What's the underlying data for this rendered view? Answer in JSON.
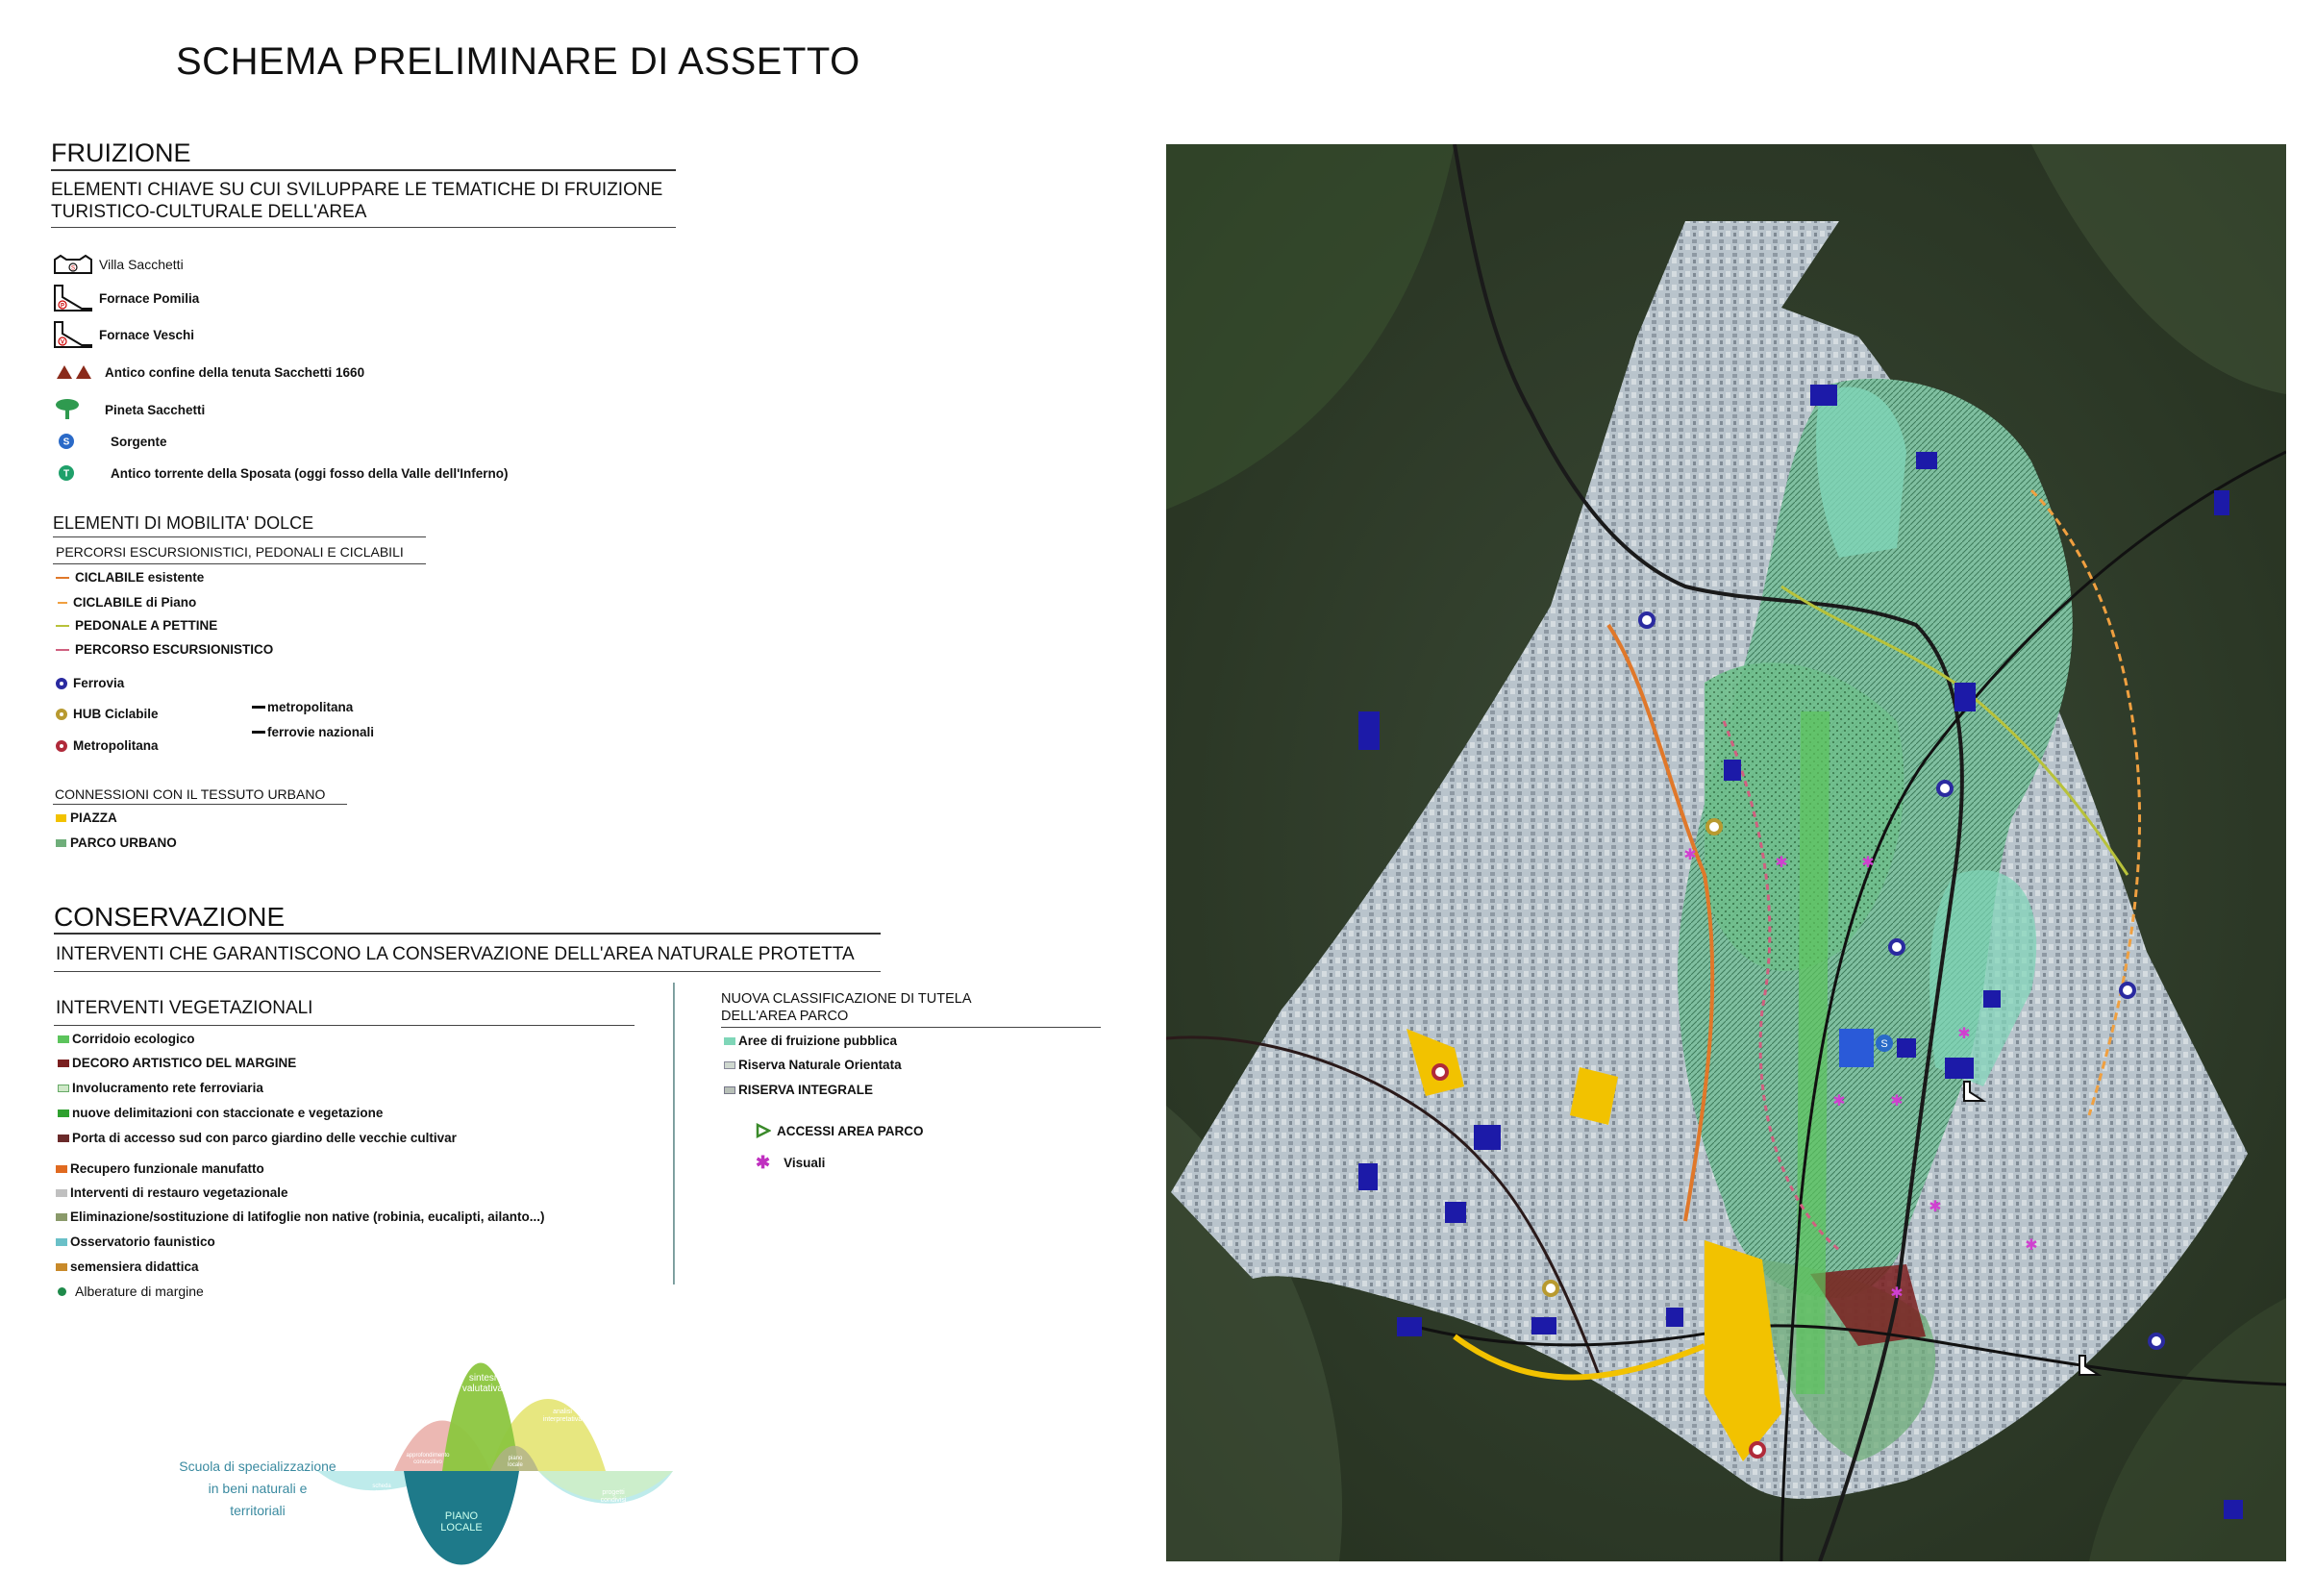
{
  "title": "SCHEMA PRELIMINARE DI ASSETTO",
  "fruizione": {
    "heading": "FRUIZIONE",
    "subtitle_line1": "ELEMENTI CHIAVE SU CUI SVILUPPARE LE TEMATICHE DI FRUIZIONE",
    "subtitle_line2": "TURISTICO-CULTURALE DELL'AREA",
    "items": [
      {
        "label": "Villa Sacchetti",
        "icon": "villa-icon",
        "badge": "S"
      },
      {
        "label": "Fornace Pomilia",
        "icon": "kiln-icon",
        "badge": "P"
      },
      {
        "label": "Fornace Veschi",
        "icon": "kiln-icon",
        "badge": "V"
      },
      {
        "label": "Antico confine della tenuta Sacchetti 1660",
        "icon": "boundary-icon"
      },
      {
        "label": "Pineta Sacchetti",
        "icon": "pine-tree-icon"
      },
      {
        "label": "Sorgente",
        "icon": "spring-icon",
        "badge": "S"
      },
      {
        "label": "Antico torrente della Sposata (oggi fosso della Valle dell'Inferno)",
        "icon": "stream-icon",
        "badge": "T"
      }
    ]
  },
  "mobilita": {
    "heading": "ELEMENTI DI MOBILITA' DOLCE",
    "subheading": "PERCORSI ESCURSIONISTICI, PEDONALI E CICLABILI",
    "paths": [
      {
        "label": "CICLABILE esistente",
        "color": "#e0782a"
      },
      {
        "label": "CICLABILE di Piano",
        "color": "#f0a040"
      },
      {
        "label": "PEDONALE A PETTINE",
        "color": "#b8c23a"
      },
      {
        "label": "PERCORSO ESCURSIONISTICO",
        "color": "#d06080"
      }
    ],
    "stations": [
      {
        "label": "Ferrovia",
        "color": "#2a2aa0"
      },
      {
        "label": "HUB Ciclabile",
        "color": "#b89a30"
      },
      {
        "label": "Metropolitana",
        "color": "#b02a3a"
      }
    ],
    "lines": [
      {
        "label": "metropolitana",
        "color": "#111111"
      },
      {
        "label": "ferrovie nazionali",
        "color": "#111111"
      }
    ],
    "connessioni_heading": "CONNESSIONI CON IL TESSUTO URBANO",
    "connessioni": [
      {
        "label": "PIAZZA",
        "color": "#f2c200"
      },
      {
        "label": "PARCO URBANO",
        "color": "#6fae7a"
      }
    ]
  },
  "conservazione": {
    "heading": "CONSERVAZIONE",
    "subtitle": "INTERVENTI CHE GARANTISCONO LA CONSERVAZIONE  DELL'AREA NATURALE PROTETTA",
    "vegetazionali_heading": "INTERVENTI VEGETAZIONALI",
    "vegetazionali": [
      {
        "label": "Corridoio ecologico",
        "color": "#5cc45c"
      },
      {
        "label": "DECORO ARTISTICO DEL MARGINE",
        "color": "#7a1f1f"
      },
      {
        "label": "Involucramento rete ferroviaria",
        "color": "#cfe8c8"
      },
      {
        "label": "nuove delimitazioni con staccionate e vegetazione",
        "color": "#2fa02f"
      },
      {
        "label": "Porta di accesso sud con parco giardino delle vecchie cultivar",
        "color": "#6a2a2a"
      },
      {
        "label": "Recupero funzionale manufatto",
        "color": "#e06a20"
      },
      {
        "label": "Interventi di restauro vegetazionale",
        "color": "#c0c0c0"
      },
      {
        "label": "Eliminazione/sostituzione di latifoglie non native (robinia, eucalipti, ailanto...)",
        "color": "#8a9a6a"
      },
      {
        "label": "Osservatorio faunistico",
        "color": "#6ac0c8"
      },
      {
        "label": "semensiera didattica",
        "color": "#c88a2a"
      },
      {
        "label": "Alberature di margine",
        "color": "#1e8a4a"
      }
    ],
    "tutela_heading_line1": "NUOVA CLASSIFICAZIONE DI TUTELA",
    "tutela_heading_line2": "DELL'AREA PARCO",
    "tutela": [
      {
        "label": "Aree di fruizione pubblica",
        "color": "#7fd6b8"
      },
      {
        "label": "Riserva Naturale Orientata",
        "color": "#cfd8cf"
      },
      {
        "label": "RISERVA INTEGRALE",
        "color": "#b8c0b8"
      }
    ],
    "accessi": [
      {
        "label": "ACCESSI AREA PARCO",
        "icon": "access-triangle-icon",
        "color": "#3a8a2a"
      },
      {
        "label": "Visuali",
        "icon": "viewpoint-star-icon",
        "color": "#c030c0"
      }
    ]
  },
  "diagram": {
    "caption": [
      "Scuola di specializzazione",
      "in beni naturali e",
      "territoriali"
    ],
    "labels": {
      "sintesi": [
        "sintesi",
        "valutativa"
      ],
      "approfondimento": [
        "approfondimento",
        "conoscitivo"
      ],
      "analisi": [
        "analisi",
        "interpretativa"
      ],
      "piano": [
        "PIANO",
        "LOCALE"
      ],
      "scheda": [
        "scheda",
        "partecipata"
      ],
      "piano_locale_small": [
        "piano",
        "locale"
      ],
      "progetti": [
        "progetti",
        "condivisi"
      ]
    }
  },
  "map": {
    "description_icons": [
      "park-area",
      "railway",
      "metro-line",
      "bike-paths",
      "piazze",
      "viewpoints"
    ]
  }
}
